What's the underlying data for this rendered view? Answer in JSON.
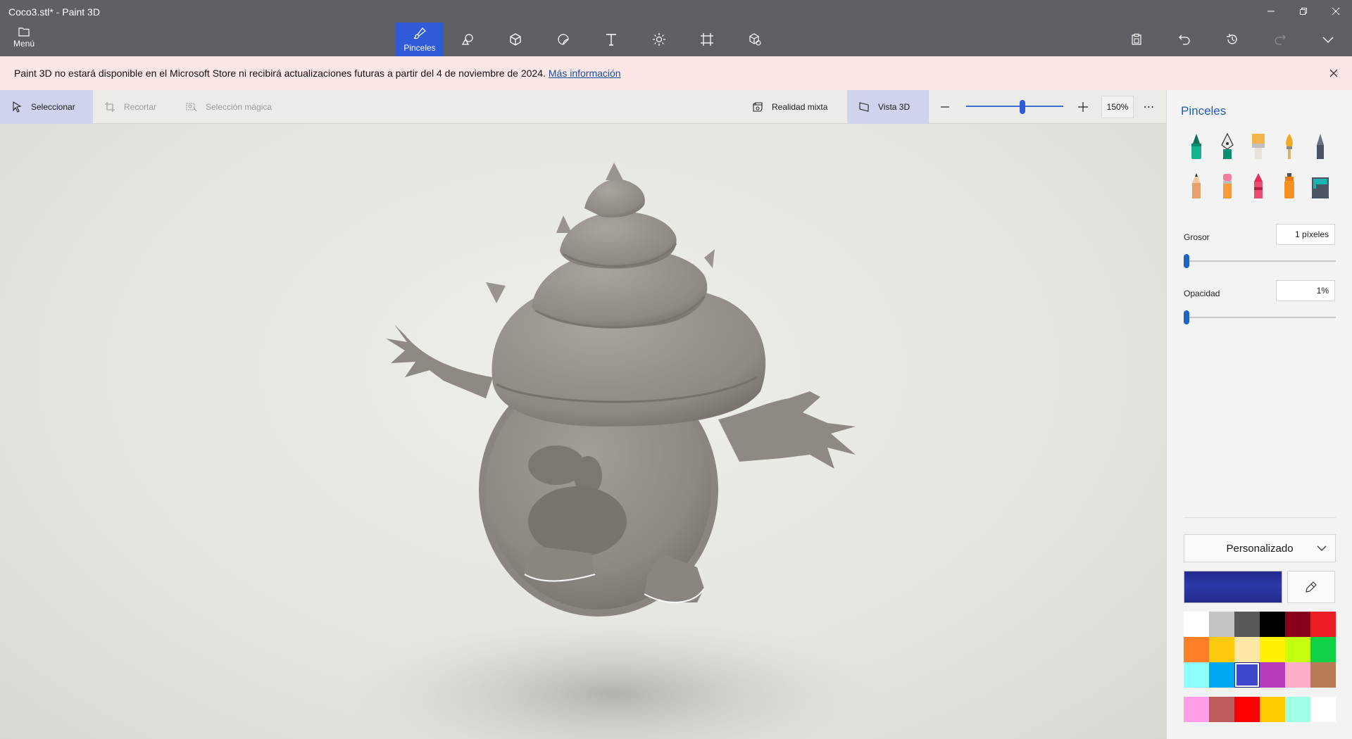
{
  "window": {
    "title": "Coco3.stl* - Paint 3D",
    "controls": [
      "minimize-icon",
      "restore-icon",
      "close-icon"
    ]
  },
  "toolbar": {
    "menu_label": "Menú",
    "tools": [
      {
        "id": "brushes",
        "label": "Pinceles",
        "icon": "brush-icon",
        "active": true
      },
      {
        "id": "2d-shapes",
        "label": "",
        "icon": "shapes-2d-icon",
        "active": false
      },
      {
        "id": "3d-shapes",
        "label": "",
        "icon": "cube-icon",
        "active": false
      },
      {
        "id": "stickers",
        "label": "",
        "icon": "sticker-icon",
        "active": false
      },
      {
        "id": "text",
        "label": "",
        "icon": "text-icon",
        "active": false
      },
      {
        "id": "effects",
        "label": "",
        "icon": "sun-icon",
        "active": false
      },
      {
        "id": "canvas",
        "label": "",
        "icon": "crop-canvas-icon",
        "active": false
      },
      {
        "id": "3d-library",
        "label": "",
        "icon": "library-3d-icon",
        "active": false
      }
    ],
    "right_tools": [
      "paste-icon",
      "undo-icon",
      "history-icon",
      "redo-icon",
      "expand-icon"
    ]
  },
  "notice": {
    "text": "Paint 3D no estará disponible en el Microsoft Store ni recibirá actualizaciones futuras a partir del 4 de noviembre de 2024.",
    "link": "Más información"
  },
  "canvas_toolbar": {
    "select": "Seleccionar",
    "crop": "Recortar",
    "magic_select": "Selección mágica",
    "mixed_reality": "Realidad mixta",
    "view3d": "Vista 3D",
    "zoom_value": "150%",
    "zoom_level": 0.58
  },
  "panel": {
    "title": "Pinceles",
    "brushes": [
      {
        "name": "marker-icon",
        "color": "#11a37f"
      },
      {
        "name": "calligraphy-pen-icon",
        "color": "#0e8d6e"
      },
      {
        "name": "oil-brush-icon",
        "color": "#e8a33a"
      },
      {
        "name": "watercolor-icon",
        "color": "#e89d1f"
      },
      {
        "name": "pixel-pen-icon",
        "color": "#4b5563"
      },
      {
        "name": "pencil-icon",
        "color": "#e6a06e"
      },
      {
        "name": "eraser-icon",
        "color": "#e94c74"
      },
      {
        "name": "crayon-icon",
        "color": "#e22d5a"
      },
      {
        "name": "spray-can-icon",
        "color": "#f07b12"
      },
      {
        "name": "fill-bucket-icon",
        "color": "#19b3b0"
      }
    ],
    "thickness_label": "Grosor",
    "thickness_value": "1 píxeles",
    "opacity_label": "Opacidad",
    "opacity_value": "1%",
    "color_mode": "Personalizado",
    "current_color": "#222a8c",
    "palette": [
      "#ffffff",
      "#c3c3c3",
      "#585858",
      "#000000",
      "#88001b",
      "#ec1c24",
      "#ff7f27",
      "#ffc90e",
      "#fde8a8",
      "#fff200",
      "#c4ff0e",
      "#0ed145",
      "#8cfffb",
      "#00a8f3",
      "#3f48cc",
      "#b83dba",
      "#ffaec8",
      "#b97a56"
    ],
    "selected_swatch": 14,
    "custom_palette": [
      "#ff9de8",
      "#be5a5a",
      "#ff0000",
      "#ffcc00",
      "#a0ffe6",
      "#ffffff"
    ]
  }
}
